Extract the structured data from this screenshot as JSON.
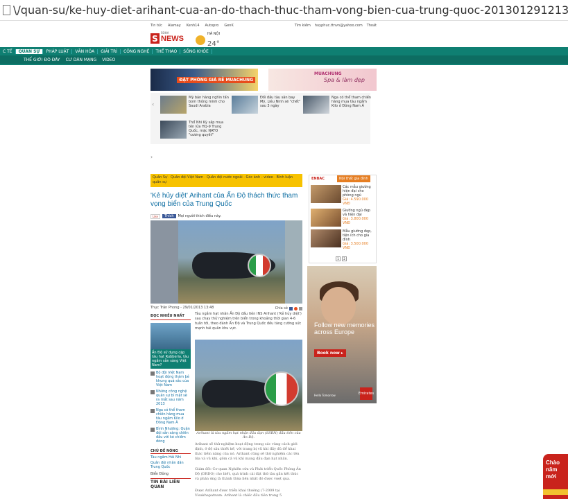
{
  "browser": {
    "url": "\\/quan-su/ke-huy-diet-arihant-cua-an-do-thach-thuc-tham-vong-bien-cua-trung-quoc-20130129121354583.htm"
  },
  "topstrip": {
    "links": [
      "Tin tức",
      "Alamay",
      "Kenh14",
      "Autopro",
      "GenK"
    ],
    "right": [
      "Tìm kiếm",
      "huyphuc.ttnvn@yahoo.com",
      "Thoát"
    ]
  },
  "site": {
    "logo_s": "S",
    "logo_news": "NEWS",
    "logo_small": "SOHA",
    "weather_city": "HÀ NỘI",
    "weather_temp": "24°"
  },
  "nav": {
    "row1": [
      "C TẾ",
      "QUÂN SỰ",
      "PHÁP LUẬT",
      "VĂN HÓA",
      "GIẢI TRÍ",
      "CÔNG NGHỆ",
      "THỂ THAO",
      "SỐNG KHỎE"
    ],
    "row2": [
      "THẾ GIỚI ĐÓ ĐÂY",
      "CƯ DÂN MẠNG",
      "VIDEO"
    ]
  },
  "ads": {
    "ad1_text": "ĐẶT PHÒNG GIÁ RẺ MUACHUNG",
    "ad2_brand": "MUACHUNG",
    "ad2_text": "Spa & làm đẹp"
  },
  "related": {
    "items": [
      "Mỹ bán hàng nghìn tấn bom thông minh cho Saudi Arabia",
      "Đối đầu tàu sân bay Mỹ, Liêu Ninh sẽ \"chết\" sau 3 ngày",
      "Nga có thể tham chiến hàng mua tàu ngầm Kilo ở Đông Nam Á",
      "Thổ Nhĩ Kỳ sắp mua tên lửa HQ-9 Trung Quốc, mặc NATO \"cương quyết\""
    ]
  },
  "article": {
    "categories": "Quân Sự · Quân đội Việt Nam · Quân đội nước ngoài · Góc ảnh - video · Bình luận quân sự",
    "title": "'Kẻ hủy diệt' Arihant của Ấn Độ thách thức tham vọng biển của Trung Quốc",
    "like_label": "Thích",
    "like_text": "Mọi người thích điều này.",
    "author": "Thục Trân Phong - 29/01/2013 13:48",
    "share_label": "Chia sẻ",
    "lead": "Tàu ngầm hạt nhân Ấn Độ đầu tiên INS Arihant ('Kẻ hủy diệt') sau chạy thử nghiệm trên biển trong khoảng thời gian 4-6 tuần tới, theo đánh Ấn Độ và Trung Quốc đều tăng cường sức mạnh hải quân khu vực.",
    "caption": "Arihant là tàu ngầm hạt nhân đầu đạn (SSBN) đầu tiên của Ấn Độ.",
    "body": [
      "Arihant sẽ thử nghiệm hoạt động trong các vùng cách giới định, ở độ sâu thiết kế, với trang bị vũ khí đầy đủ để khai thác tiềm năng của nó. Arihant cũng sẽ thử nghiệm các tên lửa và vũ khí, gồm cả vũ khí mang đầu đạn hạt nhân.",
      "Giám đốc Cơ quan Nghiên cứu và Phát triển Quốc Phòng Ấn Độ (DRDO) cho biết, quá trình cài đặt thử tàu gần kết thúc và phản ứng là thành thừa liên nhất đó được vượt qua.",
      "Được Arihant được triển khai thường (7-2009 tại Visakhapatnam. Arihant là chiếc đầu tiên trong 5"
    ]
  },
  "sidebar_left": {
    "most_read": "ĐỌC NHIỀU NHẤT",
    "feature_caption": "Ấn Độ sử dụng cặp tàu hạt Rubberia, tàu ngầm sẵn sàng Việt Nam?",
    "items": [
      "Bộ đội Việt Nam hoạt động thám bẻ khung quả sắc của Việt Nam",
      "Những công nghệ quân sự bí mật sẽ ra mắt sau năm 2013",
      "Nga có thể tham chiến hàng mua tàu ngầm Kilo ở Đông Nam Á",
      "Bình Nhưỡng: Quân đội sẵn sàng chiến đấu với kẻ chiếm đóng"
    ],
    "topic_head": "CHỦ ĐỀ NÓNG",
    "topics": [
      "Tàu ngầm Hải Nhi",
      "Quân đội nhân dân Trung Quốc"
    ],
    "topic3": "Biển Đông",
    "related_head": "TIN BÀI LIÊN QUAN"
  },
  "shop": {
    "brand": "ENBAC",
    "tab": "Nội thất gia đình",
    "items": [
      {
        "title": "Các mẫu giường hiện đại cho phòng ngủ",
        "price": "Giá: 4.590.000 VNĐ"
      },
      {
        "title": "Giường ngủ đẹp và hiện đại",
        "price": "Giá: 3.800.000 VNĐ"
      },
      {
        "title": "Mẫu giường đẹp, tiện ích cho gia đình",
        "price": "Giá: 3.500.000 VNĐ"
      }
    ],
    "pages": [
      "1",
      "2"
    ]
  },
  "big_ad": {
    "text": "Follow new memories across Europe",
    "button": "Book now ▸",
    "foot": "Hello Tomorrow",
    "brand": "Emirates"
  },
  "corner": {
    "text": "Chào năm mới"
  }
}
